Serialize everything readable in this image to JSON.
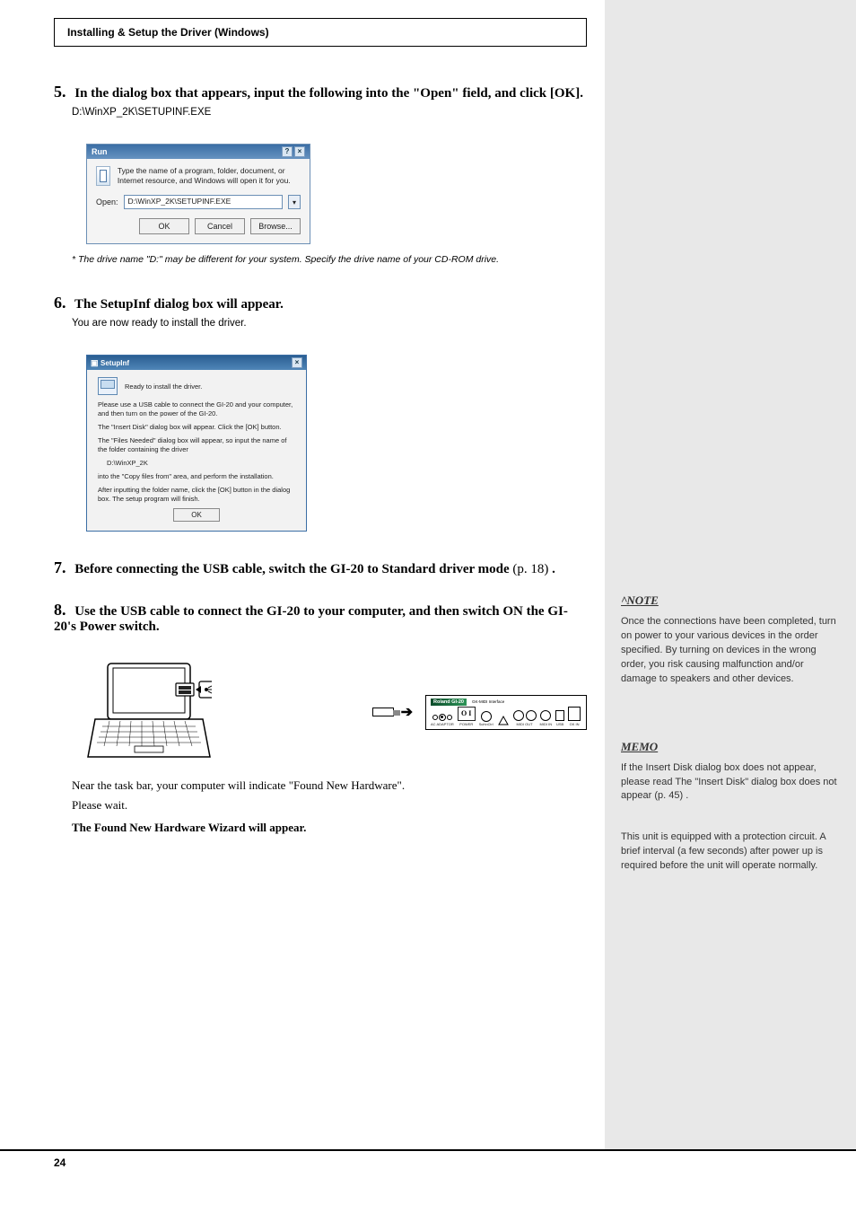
{
  "header": {
    "chapter_title": "Installing & Setup the Driver (Windows)"
  },
  "steps": {
    "s5": {
      "num": "5.",
      "head": "In the dialog box that appears, input the following into the \"Open\" field, and click [OK].",
      "body": "D:\\WinXP_2K\\SETUPINF.EXE"
    },
    "run_note": "* The drive name \"D:\" may be different for your system. Specify the drive name of your CD-ROM drive.",
    "s6": {
      "num": "6.",
      "head": "The SetupInf dialog box will appear.",
      "body": "You are now ready to install the driver."
    },
    "s7": {
      "num": "7.",
      "head_prefix": "Before connecting the USB cable, switch the GI-20 to Standard driver mode",
      "head_ref": " (p. 18)",
      "head_suffix": "."
    },
    "s8": {
      "num": "8.",
      "head": "Use the USB cable to connect the GI-20 to your computer, and then switch ON the GI-20's Power switch.",
      "body1": "Near the task bar, your computer will indicate \"Found New Hardware\".",
      "body2": "Please wait.",
      "body3": "The Found New Hardware Wizard will appear."
    }
  },
  "run_dialog": {
    "title": "Run",
    "desc": "Type the name of a program, folder, document, or Internet resource, and Windows will open it for you.",
    "open_label": "Open:",
    "open_value": "D:\\WinXP_2K\\SETUPINF.EXE",
    "ok": "OK",
    "cancel": "Cancel",
    "browse": "Browse..."
  },
  "setup_dialog": {
    "title": "SetupInf",
    "ready": "Ready to install the driver.",
    "p1": "Please use a USB cable to connect the GI-20 and your computer, and then turn on the power of the GI-20.",
    "p2": "The \"Insert Disk\" dialog box will appear. Click the [OK] button.",
    "p3": "The \"Files Needed\" dialog box will appear, so input the name of the folder containing the driver",
    "path": "D:\\WinXP_2K",
    "p4": "into the \"Copy files from\" area, and perform the installation.",
    "p5": "After inputting the folder name, click the [OK] button in the dialog box. The setup program will finish.",
    "ok": "OK"
  },
  "diagram": {
    "usb_label": "USB",
    "brand": "Roland",
    "model_prefix": "GI-",
    "model_strong": "20",
    "model_sub": "GK-MIDI Interface",
    "ac_adaptor": "AC ADAPTOR",
    "power": "POWER",
    "midi_out": "MIDI OUT",
    "midi_in": "MIDI IN",
    "gk_in": "GK IN"
  },
  "sidebar": {
    "note_block": "Once the connections have been completed, turn on power to your various devices in the order specified. By turning on devices in the wrong order, you risk causing malfunction and/or damage to speakers and other devices.",
    "memo1": "If the Insert Disk dialog box does not appear, please read The \"Insert Disk\" dialog box does not appear",
    "memo1_ref": " (p. 45)",
    "memo1_end": ".",
    "memo2": "This unit is equipped with a protection circuit. A brief interval (a few seconds) after power up is required before the unit will operate normally."
  },
  "footer": {
    "page": "24"
  }
}
